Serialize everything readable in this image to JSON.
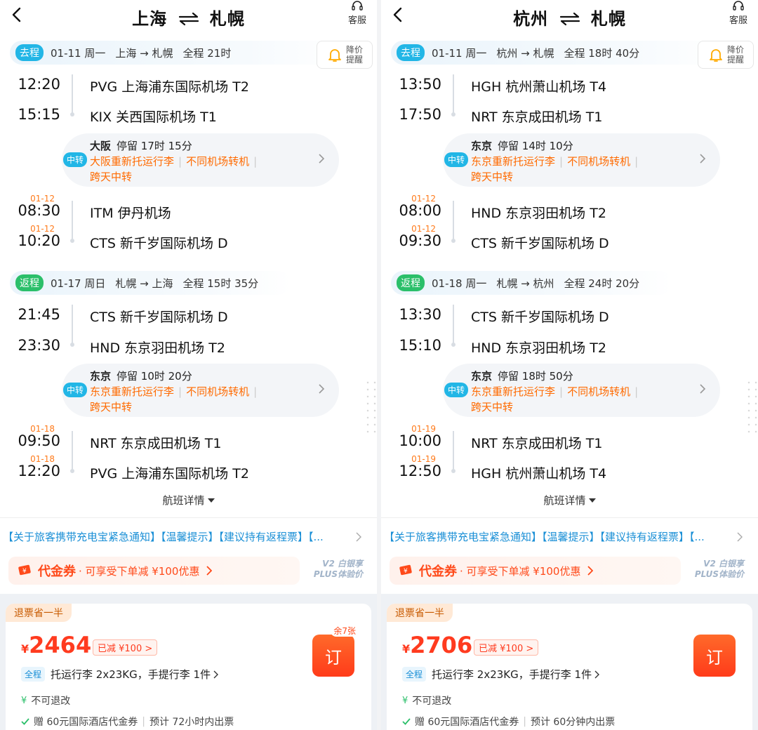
{
  "panels": [
    {
      "header": {
        "from": "上海",
        "to": "札幌",
        "service": "客服"
      },
      "price_alert": [
        "降价",
        "提醒"
      ],
      "outbound": {
        "tag": "去程",
        "date": "01-11 周一",
        "route": "上海 → 札幌",
        "total": "全程 21时"
      },
      "out_legs": [
        {
          "time": "12:20",
          "airport": "PVG 上海浦东国际机场 T2"
        },
        {
          "time": "15:15",
          "airport": "KIX 关西国际机场 T1"
        },
        {
          "date": "01-12",
          "time": "08:30",
          "airport": "ITM 伊丹机场"
        },
        {
          "date": "01-12",
          "time": "10:20",
          "airport": "CTS 新千岁国际机场 D"
        }
      ],
      "out_transfer": {
        "badge": "中转",
        "city": "大阪",
        "stay": "停留 17时 15分",
        "tip1": "大阪重新托运行李",
        "tip2": "不同机场转机",
        "tip3": "跨天中转"
      },
      "return": {
        "tag": "返程",
        "date": "01-17 周日",
        "route": "札幌 → 上海",
        "total": "全程 15时 35分"
      },
      "ret_legs": [
        {
          "time": "21:45",
          "airport": "CTS 新千岁国际机场 D"
        },
        {
          "time": "23:30",
          "airport": "HND 东京羽田机场 T2"
        },
        {
          "date": "01-18",
          "time": "09:50",
          "airport": "NRT 东京成田机场 T1"
        },
        {
          "date": "01-18",
          "time": "12:20",
          "airport": "PVG 上海浦东国际机场 T2"
        }
      ],
      "ret_transfer": {
        "badge": "中转",
        "city": "东京",
        "stay": "停留 10时 20分",
        "tip1": "东京重新托运行李",
        "tip2": "不同机场转机",
        "tip3": "跨天中转"
      },
      "details": "航班详情",
      "notice": "【关于旅客携带充电宝紧急通知】【温馨提示】【建议持有返程票】【...",
      "coupon": {
        "name": "代金券",
        "desc": "· 可享受下单减 ¥100优惠"
      },
      "plus": [
        "V2 白银享",
        "PLUS体验价"
      ],
      "card": {
        "refund_tag": "退票省一半",
        "currency": "¥",
        "price": "2464",
        "cut": "已减 ¥100 >",
        "seats_left": "余7张",
        "book": "订",
        "luggage_tag": "全程",
        "luggage": "托运行李 2x23KG，手提行李 1件",
        "no_refund_icon": "¥",
        "no_refund": "不可退改",
        "gift": "赠 60元国际酒店代金券",
        "ticketing": "预计 72小时内出票"
      }
    },
    {
      "header": {
        "from": "杭州",
        "to": "札幌",
        "service": "客服"
      },
      "price_alert": [
        "降价",
        "提醒"
      ],
      "outbound": {
        "tag": "去程",
        "date": "01-11 周一",
        "route": "杭州 → 札幌",
        "total": "全程 18时 40分"
      },
      "out_legs": [
        {
          "time": "13:50",
          "airport": "HGH 杭州萧山机场 T4"
        },
        {
          "time": "17:50",
          "airport": "NRT 东京成田机场 T1"
        },
        {
          "date": "01-12",
          "time": "08:00",
          "airport": "HND 东京羽田机场 T2"
        },
        {
          "date": "01-12",
          "time": "09:30",
          "airport": "CTS 新千岁国际机场 D"
        }
      ],
      "out_transfer": {
        "badge": "中转",
        "city": "东京",
        "stay": "停留 14时 10分",
        "tip1": "东京重新托运行李",
        "tip2": "不同机场转机",
        "tip3": "跨天中转"
      },
      "return": {
        "tag": "返程",
        "date": "01-18 周一",
        "route": "札幌 → 杭州",
        "total": "全程 24时 20分"
      },
      "ret_legs": [
        {
          "time": "13:30",
          "airport": "CTS 新千岁国际机场 D"
        },
        {
          "time": "15:10",
          "airport": "HND 东京羽田机场 T2"
        },
        {
          "date": "01-19",
          "time": "10:00",
          "airport": "NRT 东京成田机场 T1"
        },
        {
          "date": "01-19",
          "time": "12:50",
          "airport": "HGH 杭州萧山机场 T4"
        }
      ],
      "ret_transfer": {
        "badge": "中转",
        "city": "东京",
        "stay": "停留 18时 50分",
        "tip1": "东京重新托运行李",
        "tip2": "不同机场转机",
        "tip3": "跨天中转"
      },
      "details": "航班详情",
      "notice": "【关于旅客携带充电宝紧急通知】【温馨提示】【建议持有返程票】【...",
      "coupon": {
        "name": "代金券",
        "desc": "· 可享受下单减 ¥100优惠"
      },
      "plus": [
        "V2 白银享",
        "PLUS体验价"
      ],
      "card": {
        "refund_tag": "退票省一半",
        "currency": "¥",
        "price": "2706",
        "cut": "已减 ¥100 >",
        "seats_left": "",
        "book": "订",
        "luggage_tag": "全程",
        "luggage": "托运行李 2x23KG，手提行李 1件",
        "no_refund_icon": "¥",
        "no_refund": "不可退改",
        "gift": "赠 60元国际酒店代金券",
        "ticketing": "预计 60分钟内出票"
      }
    }
  ],
  "colors": {
    "accent_blue": "#22b6e6",
    "return_green": "#2bbf6a",
    "orange": "#ff6a00",
    "price_red": "#ff3b1f"
  }
}
